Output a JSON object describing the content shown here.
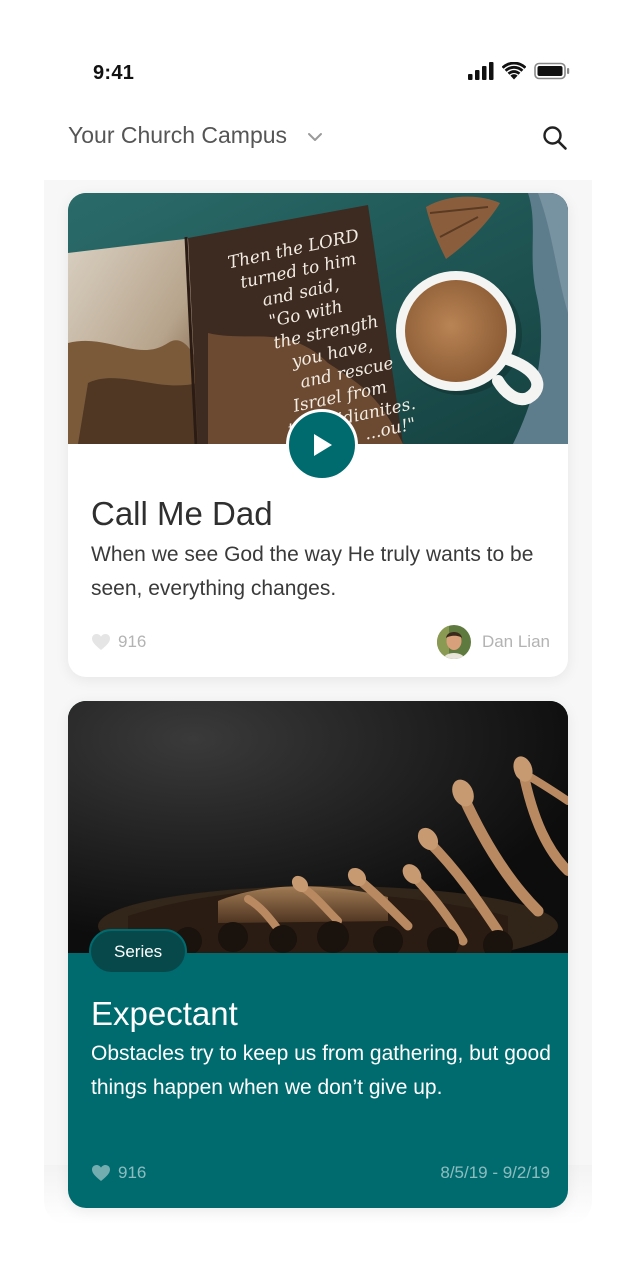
{
  "status_bar": {
    "time": "9:41",
    "icons": [
      "cellular-signal-icon",
      "wifi-icon",
      "battery-icon"
    ]
  },
  "header": {
    "campus": "Your Church Campus",
    "campus_icon": "chevron-down-icon",
    "search_icon": "search-icon"
  },
  "colors": {
    "brand": "#006b6f",
    "brand_dark": "#07494b",
    "text": "#2f2f2f",
    "muted": "#b3b3b3"
  },
  "cards": [
    {
      "image": "open-bible-and-coffee-photo",
      "bible_text": [
        "Then the LORD",
        "turned to him",
        "and said,",
        "\"Go with",
        "the strength",
        "you have,",
        "and rescue",
        "Israel from",
        "the Midianites.",
        "...ou!\""
      ],
      "play_icon": "play-icon",
      "title": "Call Me Dad",
      "description": "When we see God the way He truly wants to be seen, everything changes.",
      "likes": "916",
      "author": "Dan Lian"
    },
    {
      "image": "worship-hands-raised-photo",
      "badge": "Series",
      "title": "Expectant",
      "description": "Obstacles try to keep us from gathering, but good things happen when we don’t give up.",
      "likes": "916",
      "date_range": "8/5/19 - 9/2/19"
    }
  ]
}
